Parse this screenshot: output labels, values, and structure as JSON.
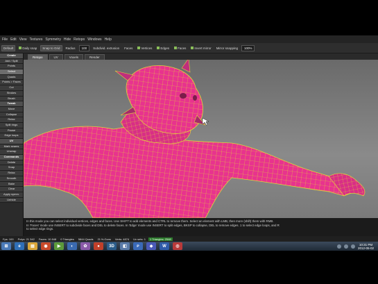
{
  "menubar": {
    "items": [
      "File",
      "Edit",
      "View",
      "Textures",
      "Symmetry",
      "Hide",
      "Retopo",
      "Windows",
      "Help"
    ]
  },
  "toolbar": {
    "preset": "Default",
    "daily_snap": "Daily snap",
    "snap_label": "Snap to Grid",
    "radius_label": "Radius",
    "radius_value": "100",
    "subdiv_label": "Subdivid. extrusion",
    "faces_label": "Faces",
    "vertices": "Vertices",
    "edges": "Edges",
    "faces": "Faces",
    "invert_mirror": "Invert mirror",
    "mirror_label": "Mirror snapping",
    "mirror_value": "100%"
  },
  "tabs": [
    {
      "label": "Retopo",
      "active": true
    },
    {
      "label": "UV",
      "active": false
    },
    {
      "label": "Voxels",
      "active": false
    },
    {
      "label": "Render",
      "active": false
    }
  ],
  "leftpanel": {
    "rows": [
      {
        "text": "Create",
        "kind": "header"
      },
      {
        "text": "Add / Split",
        "kind": "btn"
      },
      {
        "text": "Points",
        "kind": "btn"
      },
      {
        "text": "Select",
        "kind": "hot"
      },
      {
        "text": "Quads",
        "kind": "btn"
      },
      {
        "text": "Points > Faces",
        "kind": "btn"
      },
      {
        "text": "Cut",
        "kind": "btn"
      },
      {
        "text": "Strokes",
        "kind": "btn"
      },
      {
        "text": "Brush",
        "kind": "btn"
      },
      {
        "text": "Tweak",
        "kind": "header"
      },
      {
        "text": "Move",
        "kind": "btn"
      },
      {
        "text": "Collapse",
        "kind": "btn"
      },
      {
        "text": "Relax",
        "kind": "btn"
      },
      {
        "text": "Split rings",
        "kind": "btn"
      },
      {
        "text": "Pause",
        "kind": "btn"
      },
      {
        "text": "Edge loops",
        "kind": "btn"
      },
      {
        "text": "UV",
        "kind": "header"
      },
      {
        "text": "Mark seams",
        "kind": "btn"
      },
      {
        "text": "Unwrap",
        "kind": "btn"
      },
      {
        "text": "Commands",
        "kind": "header"
      },
      {
        "text": "Delete",
        "kind": "btn"
      },
      {
        "text": "Snap",
        "kind": "btn"
      },
      {
        "text": "Relax",
        "kind": "btn"
      },
      {
        "text": "Smooth",
        "kind": "btn"
      },
      {
        "text": "Bake",
        "kind": "btn"
      },
      {
        "text": "Clear",
        "kind": "btn"
      },
      {
        "text": "Apply symm.",
        "kind": "btn"
      },
      {
        "text": "Unhide",
        "kind": "btn"
      }
    ]
  },
  "helpbar": {
    "line1": "In this mode you can select individual vertices, edges and faces. Use SHIFT to add elements and CTRL to remove them. Select an element with LMB, then more (shift) them with RMB.",
    "line2": "In 'Faces' mode use INSERT to subdivide faces and DEL to delete faces. In 'Edge' mode use INSERT to split edges, BKSP to collapse, DEL to remove edges. 1 to select edge loops, and R",
    "line3": "to select edge rings."
  },
  "statusbar": {
    "fps": "Fps: 100",
    "polys": "Polys: 21 342",
    "faces_info": "Faces: 10 848",
    "tris": "0 Triangles",
    "quads": "5844 Quads",
    "ngons": "21 N-Gons",
    "verts": "Verts: 4874",
    "uv": "Uv sets: 1",
    "retopo": "1 Triangles: 2548"
  },
  "taskbar": {
    "apps": [
      {
        "glyph": "⊞",
        "color": "#4a7ab8"
      },
      {
        "glyph": "e",
        "color": "#2f6fb7"
      },
      {
        "glyph": "▤",
        "color": "#d9a63a"
      },
      {
        "glyph": "◉",
        "color": "#c84a2a"
      },
      {
        "glyph": "▶",
        "color": "#5c9a3a"
      },
      {
        "glyph": "◐",
        "color": "#3a6ab0"
      },
      {
        "glyph": "✿",
        "color": "#8a5aa8"
      },
      {
        "glyph": "●",
        "color": "#c0402a"
      },
      {
        "glyph": "3D",
        "color": "#2a5c8a"
      },
      {
        "glyph": "◧",
        "color": "#5a7aa8"
      },
      {
        "glyph": "ᴘ",
        "color": "#3a6ab8"
      },
      {
        "glyph": "◆",
        "color": "#4a5ab8"
      },
      {
        "glyph": "W",
        "color": "#2f5ba8"
      },
      {
        "glyph": "◎",
        "color": "#b83a3a"
      }
    ],
    "clock_time": "10:31 PM",
    "clock_date": "2012-05-02"
  },
  "colors": {
    "mesh_fill": "#e8338e",
    "mesh_wire": "#e2d23b",
    "viewport_bg": "#7c7c7c",
    "selected": "#6d6d6d"
  }
}
